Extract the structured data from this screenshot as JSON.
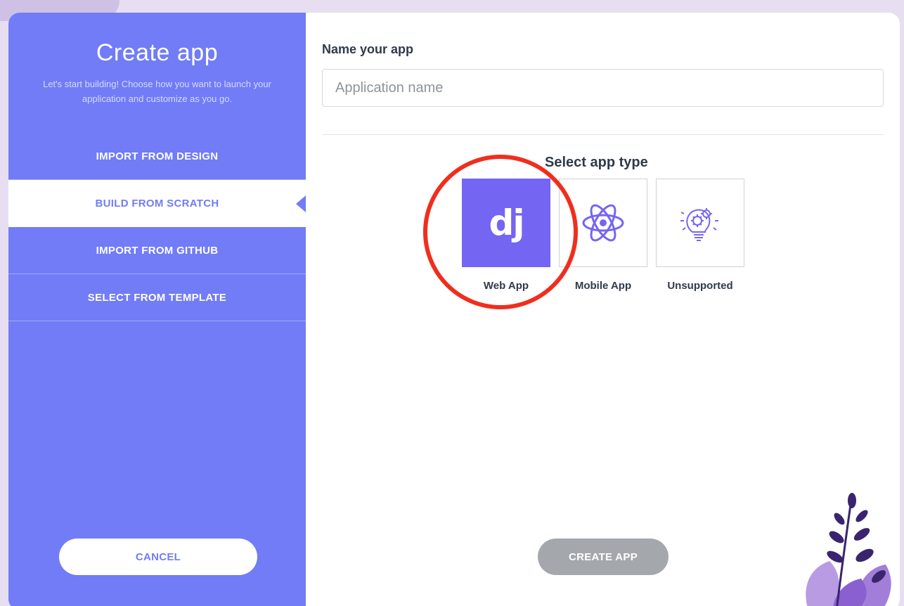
{
  "sidebar": {
    "title": "Create app",
    "subtitle": "Let's start building! Choose how you want to launch your application and customize as you go.",
    "methods": [
      {
        "label": "IMPORT FROM DESIGN",
        "active": false
      },
      {
        "label": "BUILD FROM SCRATCH",
        "active": true
      },
      {
        "label": "IMPORT FROM GITHUB",
        "active": false
      },
      {
        "label": "SELECT FROM TEMPLATE",
        "active": false
      }
    ],
    "cancel_label": "CANCEL"
  },
  "main": {
    "name_label": "Name your app",
    "name_input": {
      "value": "",
      "placeholder": "Application name"
    },
    "type_heading": "Select app type",
    "app_types": [
      {
        "label": "Web App",
        "glyph": "dj",
        "icon": "django-icon",
        "selected": true
      },
      {
        "label": "Mobile App",
        "icon": "react-atom-icon",
        "selected": false
      },
      {
        "label": "Unsupported",
        "icon": "lightbulb-gears-icon",
        "selected": false
      }
    ],
    "create_label": "CREATE APP"
  },
  "colors": {
    "sidebar_bg": "#717cf6",
    "selected_tile": "#7565f3",
    "highlight_ring": "#f02e1e",
    "disabled_button": "#a4a8ad",
    "heading_text": "#2f3a4a"
  }
}
